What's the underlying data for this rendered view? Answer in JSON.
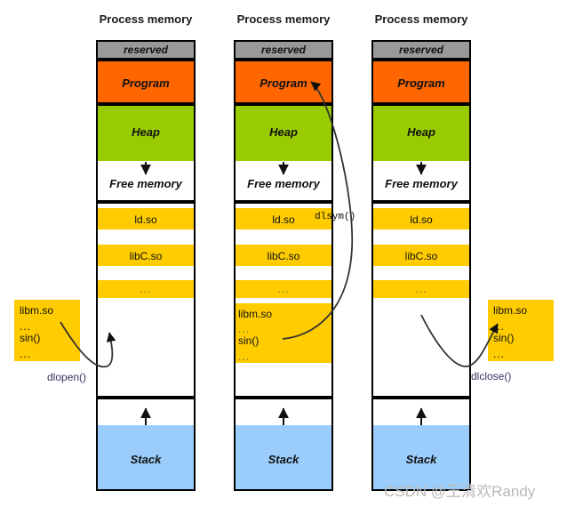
{
  "columns": [
    {
      "title": "Process memory",
      "segments": {
        "reserved": "reserved",
        "program": "Program",
        "heap": "Heap",
        "free": "Free memory",
        "stack": "Stack"
      },
      "libraries": [
        {
          "label": "ld.so",
          "align": "center"
        },
        {
          "label": "libC.so",
          "align": "center"
        },
        {
          "label": "...",
          "align": "center"
        }
      ]
    },
    {
      "title": "Process memory",
      "segments": {
        "reserved": "reserved",
        "program": "Program",
        "heap": "Heap",
        "free": "Free memory",
        "stack": "Stack"
      },
      "libraries": [
        {
          "label": "ld.so",
          "align": "center"
        },
        {
          "label": "libC.so",
          "align": "center"
        },
        {
          "label": "...",
          "align": "center"
        }
      ],
      "loaded_library": {
        "name": "libm.so",
        "dots_top": "...",
        "symbol": "sin()",
        "dots_bottom": "..."
      }
    },
    {
      "title": "Process memory",
      "segments": {
        "reserved": "reserved",
        "program": "Program",
        "heap": "Heap",
        "free": "Free memory",
        "stack": "Stack"
      },
      "libraries": [
        {
          "label": "ld.so",
          "align": "center"
        },
        {
          "label": "libC.so",
          "align": "center"
        },
        {
          "label": "...",
          "align": "center"
        }
      ]
    }
  ],
  "callout_left": {
    "name": "libm.so",
    "dots_top": "...",
    "symbol": "sin()",
    "dots_bottom": "..."
  },
  "callout_right": {
    "name": "libm.so",
    "dots_top": "...",
    "symbol": "sin()",
    "dots_bottom": "..."
  },
  "actions": {
    "dlopen": "dlopen()",
    "dlsym": "dlsym()",
    "dlclose": "dlclose()"
  },
  "watermark": "CSDN @王清欢Randy",
  "colors": {
    "reserved": "#999999",
    "program": "#FF6600",
    "heap": "#99CC00",
    "library": "#FFCC00",
    "stack": "#9ACDFB",
    "border": "#000000",
    "free": "#FFFFFF",
    "label": "#3B2F63",
    "watermark": "#B9B9B9"
  }
}
